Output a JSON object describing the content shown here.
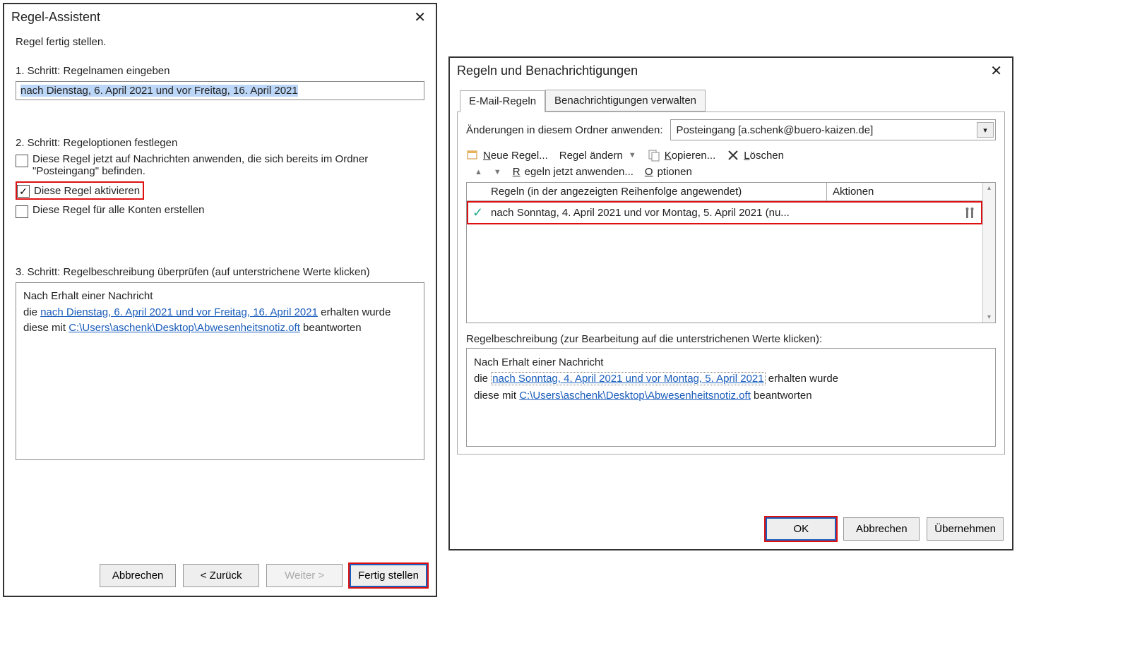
{
  "left": {
    "title": "Regel-Assistent",
    "instruction": "Regel fertig stellen.",
    "step1_label": "1. Schritt: Regelnamen eingeben",
    "rule_name": "nach Dienstag, 6. April 2021 und vor Freitag, 16. April 2021",
    "step2_label": "2. Schritt: Regeloptionen festlegen",
    "opt_apply_now": "Diese Regel jetzt auf Nachrichten anwenden, die sich bereits im Ordner \"Posteingang\" befinden.",
    "opt_activate": "Diese Regel aktivieren",
    "opt_all_accounts": "Diese Regel für alle Konten erstellen",
    "step3_label": "3. Schritt: Regelbeschreibung überprüfen (auf unterstrichene Werte klicken)",
    "desc_line1": "Nach Erhalt einer Nachricht",
    "desc_pre": "die ",
    "desc_daterange": "nach Dienstag, 6. April 2021 und vor Freitag, 16. April 2021",
    "desc_post": " erhalten wurde",
    "desc_line3_pre": "diese mit ",
    "desc_path": "C:\\Users\\aschenk\\Desktop\\Abwesenheitsnotiz.oft",
    "desc_line3_post": " beantworten",
    "btn_cancel": "Abbrechen",
    "btn_back": "<  Zurück",
    "btn_next": "Weiter  >",
    "btn_finish": "Fertig stellen"
  },
  "right": {
    "title": "Regeln und Benachrichtigungen",
    "tab1": "E-Mail-Regeln",
    "tab2": "Benachrichtigungen verwalten",
    "apply_label": "Änderungen in diesem Ordner anwenden:",
    "folder": "Posteingang [a.schenk@buero-kaizen.de]",
    "tb_new": "Neue Regel...",
    "tb_change": "Regel ändern",
    "tb_copy": "Kopieren...",
    "tb_delete": "Löschen",
    "tb_run": "Regeln jetzt anwenden...",
    "tb_options": "Optionen",
    "col_rules": "Regeln (in der angezeigten Reihenfolge angewendet)",
    "col_actions": "Aktionen",
    "rule_row": "nach Sonntag, 4. April 2021 und vor Montag, 5. April 2021  (nu...",
    "desc_label": "Regelbeschreibung (zur Bearbeitung auf die unterstrichenen Werte klicken):",
    "d_line1": "Nach Erhalt einer Nachricht",
    "d_pre": "die ",
    "d_daterange": "nach Sonntag, 4. April 2021 und vor Montag, 5. April 2021",
    "d_post": " erhalten wurde",
    "d_line3_pre": "diese mit ",
    "d_path": "C:\\Users\\aschenk\\Desktop\\Abwesenheitsnotiz.oft",
    "d_line3_post": " beantworten",
    "btn_ok": "OK",
    "btn_cancel": "Abbrechen",
    "btn_apply": "Übernehmen"
  }
}
